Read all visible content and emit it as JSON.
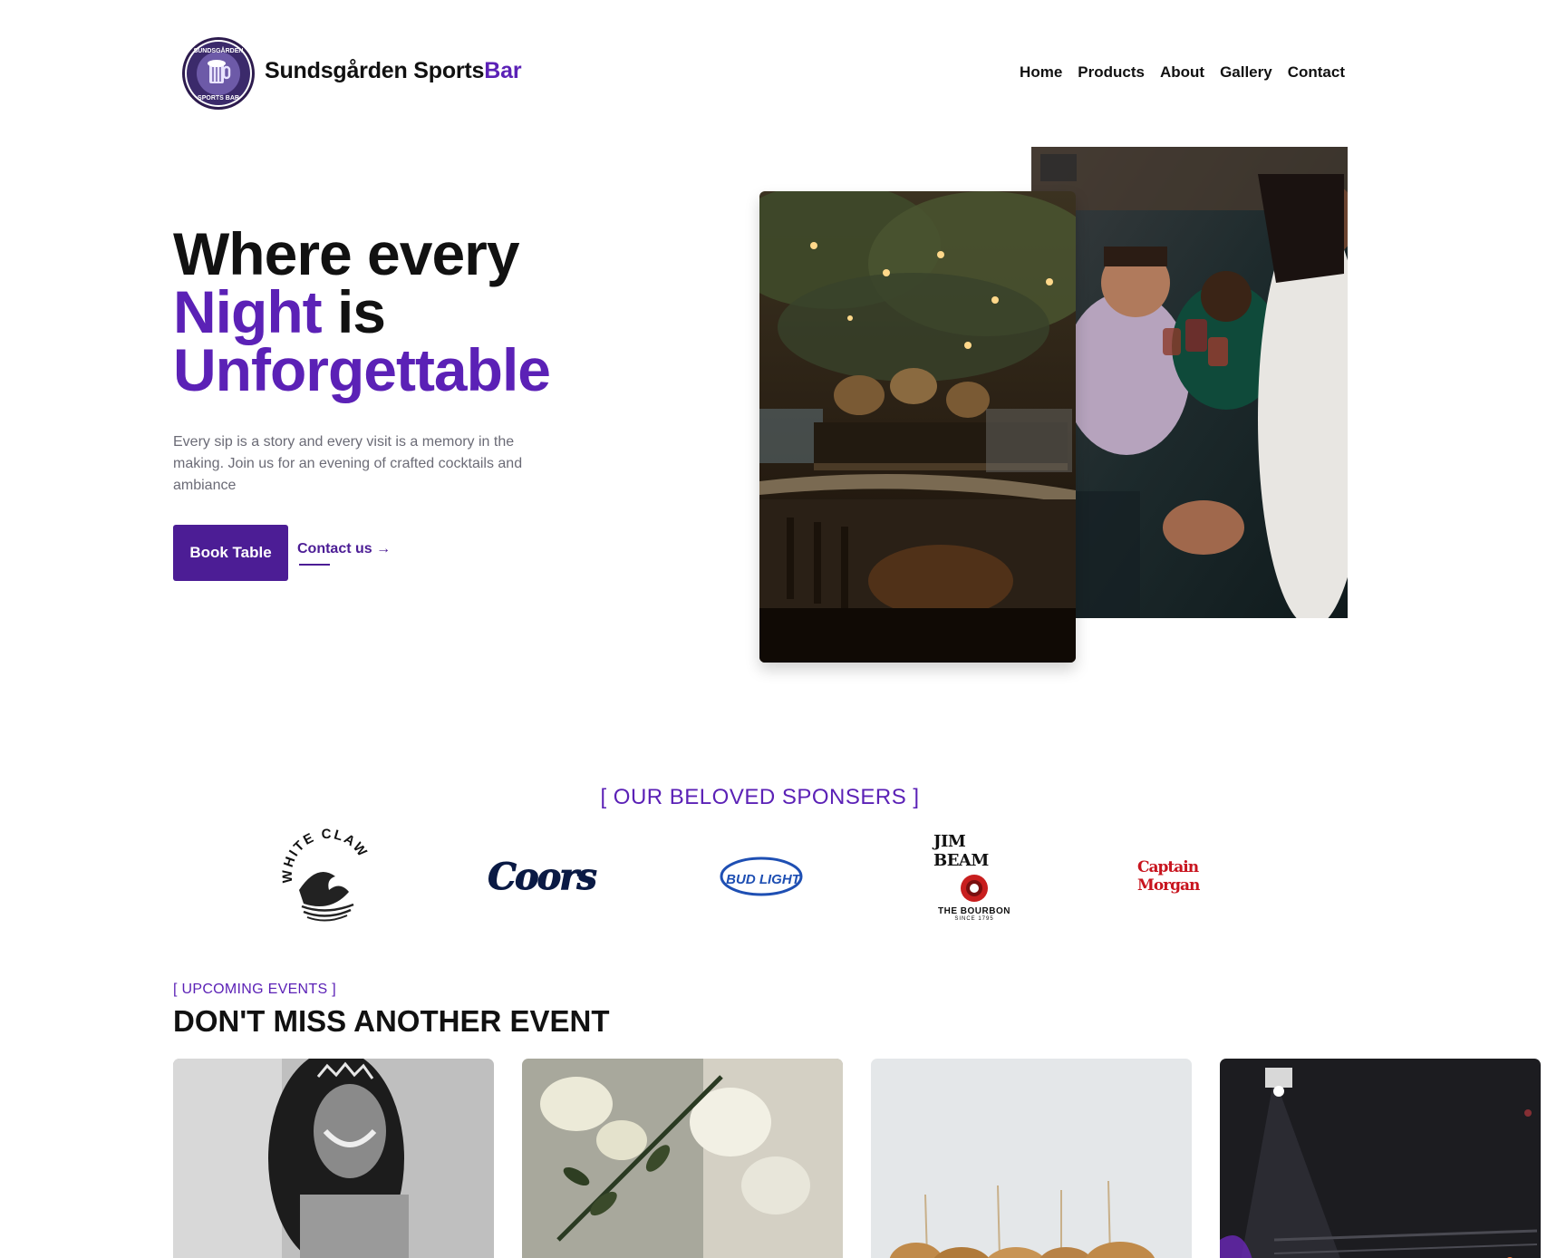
{
  "brand": {
    "name_part1": "Sundsgården Sports",
    "name_part2": "Bar",
    "logo_icon": "beer-mug-badge-icon",
    "logo_ring_text": "SUNDSGÅRDEN · SPORTS BAR"
  },
  "nav": {
    "items": [
      "Home",
      "Products",
      "About",
      "Gallery",
      "Contact"
    ]
  },
  "hero": {
    "line1": "Where every",
    "line2_accent": "Night",
    "line2_rest": " is",
    "line3_accent": "Unforgettable",
    "subtitle": "Every sip is a story and every visit is a memory in the making. Join us for an evening of crafted cocktails and ambiance",
    "primary_button": "Book Table",
    "secondary_link": "Contact us →"
  },
  "sponsors": {
    "title": "[ OUR BELOVED SPONSERS ]",
    "logos": [
      {
        "name": "WHITE CLAW"
      },
      {
        "name": "Coors"
      },
      {
        "name": "BUD LIGHT"
      },
      {
        "name": "JIM BEAM",
        "tagline": "THE BOURBON",
        "since": "SINCE 1795"
      },
      {
        "name": "Captain Morgan"
      }
    ]
  },
  "events": {
    "kicker": "[ UPCOMING EVENTS ]",
    "title": "DON'T MISS ANOTHER EVENT"
  },
  "colors": {
    "accent": "#5b21b6",
    "button": "#4c1d95",
    "muted_text": "#6b6b76"
  }
}
